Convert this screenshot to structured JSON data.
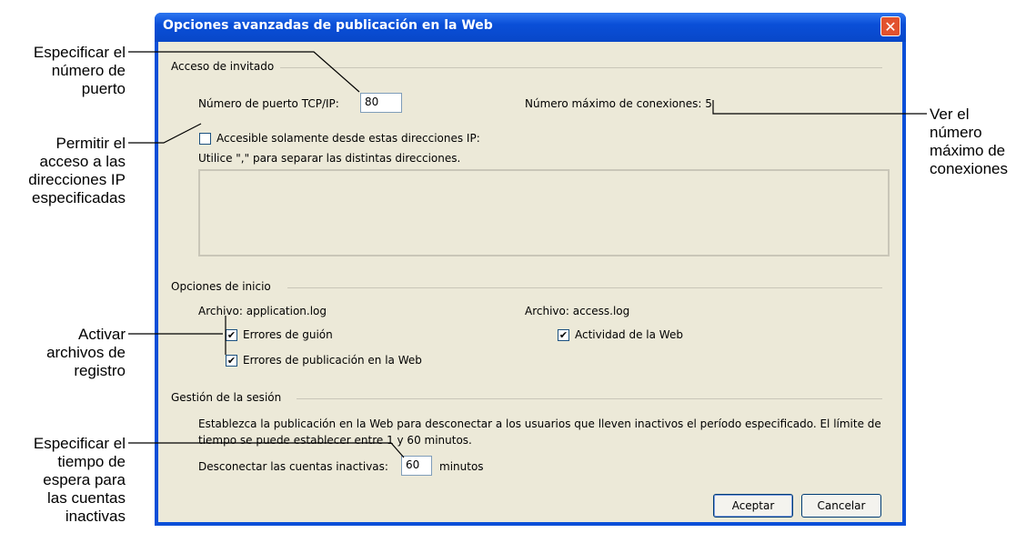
{
  "callouts": {
    "port": [
      "Especificar el",
      "número de",
      "puerto"
    ],
    "ip": [
      "Permitir el",
      "acceso a las",
      "direcciones IP",
      "especificadas"
    ],
    "logs": [
      "Activar",
      "archivos de",
      "registro"
    ],
    "timeout": [
      "Especificar el",
      "tiempo de",
      "espera para",
      "las cuentas",
      "inactivas"
    ],
    "maxconn": [
      "Ver el",
      "número",
      "máximo de",
      "conexiones"
    ]
  },
  "dialog": {
    "title": "Opciones avanzadas de publicación en la Web",
    "close_glyph": "✕",
    "guest_access": {
      "heading": "Acceso de invitado",
      "port_label": "Número de puerto TCP/IP:",
      "port_value": "80",
      "max_conn_label": "Número máximo de conexiones: 5",
      "ip_checkbox_label": "Accesible solamente desde estas direcciones IP:",
      "ip_checked": false,
      "ip_hint": "Utilice \",\" para separar las distintas direcciones."
    },
    "logging": {
      "heading": "Opciones de inicio",
      "file1": "Archivo: application.log",
      "file2": "Archivo: access.log",
      "script_errors": "Errores de guión",
      "publish_errors": "Errores de publicación en la Web",
      "web_activity": "Actividad de la Web",
      "check_glyph": "✔"
    },
    "session": {
      "heading": "Gestión de la sesión",
      "description_line1": "Establezca la publicación en la Web para desconectar a los usuarios que lleven inactivos el período especificado.  El límite de",
      "description_line2": "tiempo se puede establecer entre 1 y 60 minutos.",
      "timeout_label": "Desconectar las cuentas inactivas:",
      "timeout_value": "60",
      "timeout_unit": "minutos"
    },
    "buttons": {
      "ok": "Aceptar",
      "cancel": "Cancelar"
    }
  }
}
